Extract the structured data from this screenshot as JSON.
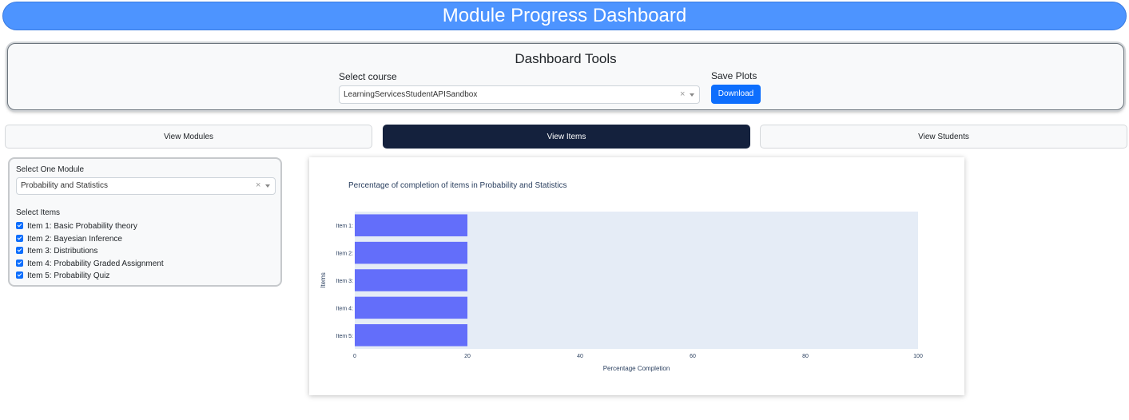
{
  "header": {
    "title": "Module Progress Dashboard"
  },
  "tools": {
    "title": "Dashboard Tools",
    "course_label": "Select course",
    "course_value": "LearningServicesStudentAPISandbox",
    "save_label": "Save Plots",
    "download_label": "Download"
  },
  "tabs": [
    {
      "label": "View Modules",
      "active": false
    },
    {
      "label": "View Items",
      "active": true
    },
    {
      "label": "View Students",
      "active": false
    }
  ],
  "module_panel": {
    "select_label": "Select One Module",
    "selected_module": "Probability and Statistics",
    "items_label": "Select Items",
    "items": [
      {
        "label": "Item 1: Basic Probability theory",
        "checked": true
      },
      {
        "label": "Item 2: Bayesian Inference",
        "checked": true
      },
      {
        "label": "Item 3: Distributions",
        "checked": true
      },
      {
        "label": "Item 4: Probability Graded Assignment",
        "checked": true
      },
      {
        "label": "Item 5: Probability Quiz",
        "checked": true
      }
    ]
  },
  "colors": {
    "accent": "#0d6efd",
    "banner": "#4d94ff",
    "active_tab": "#14213d",
    "bar": "#636efa",
    "plot_bg": "#e5ecf6"
  },
  "chart_data": {
    "type": "bar",
    "orientation": "horizontal",
    "title": "Percentage of completion of items in Probability and Statistics",
    "xlabel": "Percentage Completion",
    "ylabel": "Items",
    "categories": [
      "Item 1:",
      "Item 2:",
      "Item 3:",
      "Item 4:",
      "Item 5:"
    ],
    "values": [
      20,
      20,
      20,
      20,
      20
    ],
    "xlim": [
      0,
      100
    ],
    "xticks": [
      0,
      20,
      40,
      60,
      80,
      100
    ],
    "grid": false
  }
}
